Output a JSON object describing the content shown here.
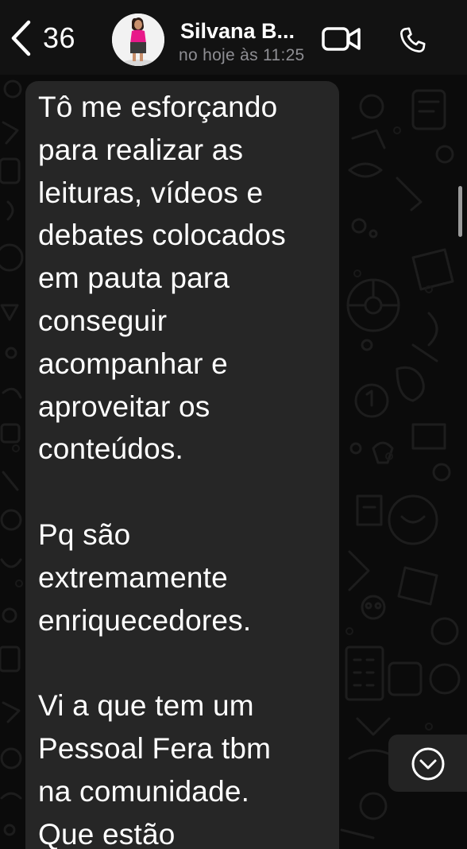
{
  "header": {
    "back_count": "36",
    "contact_name": "Silvana B...",
    "contact_status": "no hoje às 11:25"
  },
  "message": {
    "paragraphs": [
      [
        "Tô me esforçando",
        "para realizar as",
        "leituras, vídeos e",
        "debates colocados",
        "em pauta para",
        "conseguir",
        "acompanhar e",
        "aproveitar os",
        "conteúdos."
      ],
      [
        "Pq são",
        "extremamente",
        "enriquecedores."
      ],
      [
        "Vi a que tem um",
        "Pessoal Fera tbm",
        "na comunidade.",
        "Que estão"
      ]
    ]
  },
  "icons": {
    "back": "chevron-left-icon",
    "video": "video-camera-icon",
    "call": "phone-icon",
    "scroll_down": "chevron-down-circle-icon"
  },
  "colors": {
    "header_bg": "#121212",
    "chat_bg": "#0b0b0b",
    "bubble_bg": "#262626",
    "text": "#ffffff",
    "muted": "#8e8e93"
  }
}
